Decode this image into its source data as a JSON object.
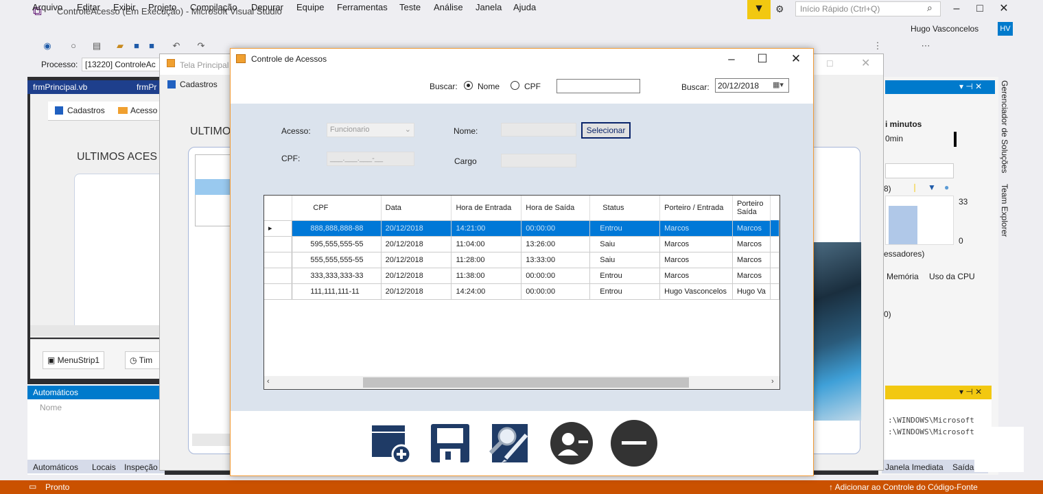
{
  "vs": {
    "title": "ControleAcesso (Em Execução) - Microsoft Visual Studio",
    "quick_launch_placeholder": "Início Rápido (Ctrl+Q)",
    "menu": [
      "Arquivo",
      "Editar",
      "Exibir",
      "Projeto",
      "Compilação",
      "Depurar",
      "Equipe",
      "Ferramentas",
      "Teste",
      "Análise",
      "Janela",
      "Ajuda"
    ],
    "user": "Hugo Vasconcelos",
    "user_initials": "HV",
    "process_label": "Processo:",
    "process_value": "[13220] ControleAc",
    "doc_tabs": [
      "frmPrincipal.vb",
      "frmPr"
    ],
    "designer": {
      "menu_items": [
        "Cadastros",
        "Acesso"
      ],
      "heading": "ULTIMOS ACES",
      "tray_items": [
        "MenuStrip1",
        "Tim"
      ]
    },
    "autos": {
      "header": "Automáticos",
      "column": "Nome",
      "tabs": [
        "Automáticos",
        "Locais",
        "Inspeção"
      ]
    },
    "right_panel": {
      "minutes": "i minutos",
      "zero_min": "0min",
      "count_top": "33",
      "count_bottom": "0",
      "paren_label": "8)",
      "processors": "essadores)",
      "tabs": [
        "Memória",
        "Uso da CPU"
      ],
      "zero_paren": "0)",
      "side_tabs": [
        "Gerenciador de Soluções",
        "Team Explorer"
      ],
      "output_lines": [
        ":\\WINDOWS\\Microsoft",
        ":\\WINDOWS\\Microsoft"
      ],
      "output_tabs": [
        "Janela Imediata",
        "Saída"
      ]
    },
    "status_left": "Pronto",
    "status_right": "Adicionar ao Controle do Código-Fonte"
  },
  "tela": {
    "title": "Tela Principal",
    "menu": "Cadastros",
    "heading": "ULTIMO"
  },
  "cda": {
    "title": "Controle de Acessos",
    "search": {
      "label": "Buscar:",
      "radio_nome": "Nome",
      "radio_cpf": "CPF",
      "selected": "Nome",
      "text_value": "",
      "date_label": "Buscar:",
      "date_value": "20/12/2018"
    },
    "form": {
      "acesso_label": "Acesso:",
      "acesso_value": "Funcionario",
      "nome_label": "Nome:",
      "nome_value": "",
      "selecionar": "Selecionar",
      "cpf_label": "CPF:",
      "cpf_value": "___.___.___-__",
      "cargo_label": "Cargo",
      "cargo_value": ""
    },
    "grid": {
      "columns": [
        "CPF",
        "Data",
        "Hora de Entrada",
        "Hora de Saída",
        "Status",
        "Porteiro / Entrada",
        "Porteiro Saída"
      ],
      "rows": [
        [
          "888,888,888-88",
          "20/12/2018",
          "14:21:00",
          "00:00:00",
          "Entrou",
          "Marcos",
          "Marcos"
        ],
        [
          "595,555,555-55",
          "20/12/2018",
          "11:04:00",
          "13:26:00",
          "Saiu",
          "Marcos",
          "Marcos"
        ],
        [
          "555,555,555-55",
          "20/12/2018",
          "11:28:00",
          "13:33:00",
          "Saiu",
          "Marcos",
          "Marcos"
        ],
        [
          "333,333,333-33",
          "20/12/2018",
          "11:38:00",
          "00:00:00",
          "Entrou",
          "Marcos",
          "Marcos"
        ],
        [
          "111,111,111-11",
          "20/12/2018",
          "14:24:00",
          "00:00:00",
          "Entrou",
          "Hugo Vasconcelos",
          "Hugo Va"
        ]
      ],
      "selected_row": 0
    },
    "actions": [
      "new-record-icon",
      "save-icon",
      "edit-search-icon",
      "remove-user-icon",
      "delete-icon"
    ]
  },
  "colors": {
    "vs_accent": "#007acc",
    "status_bar": "#ca5100",
    "selection": "#0078d7",
    "window_border": "#f29b36",
    "action_icon": "#1f3b66"
  }
}
